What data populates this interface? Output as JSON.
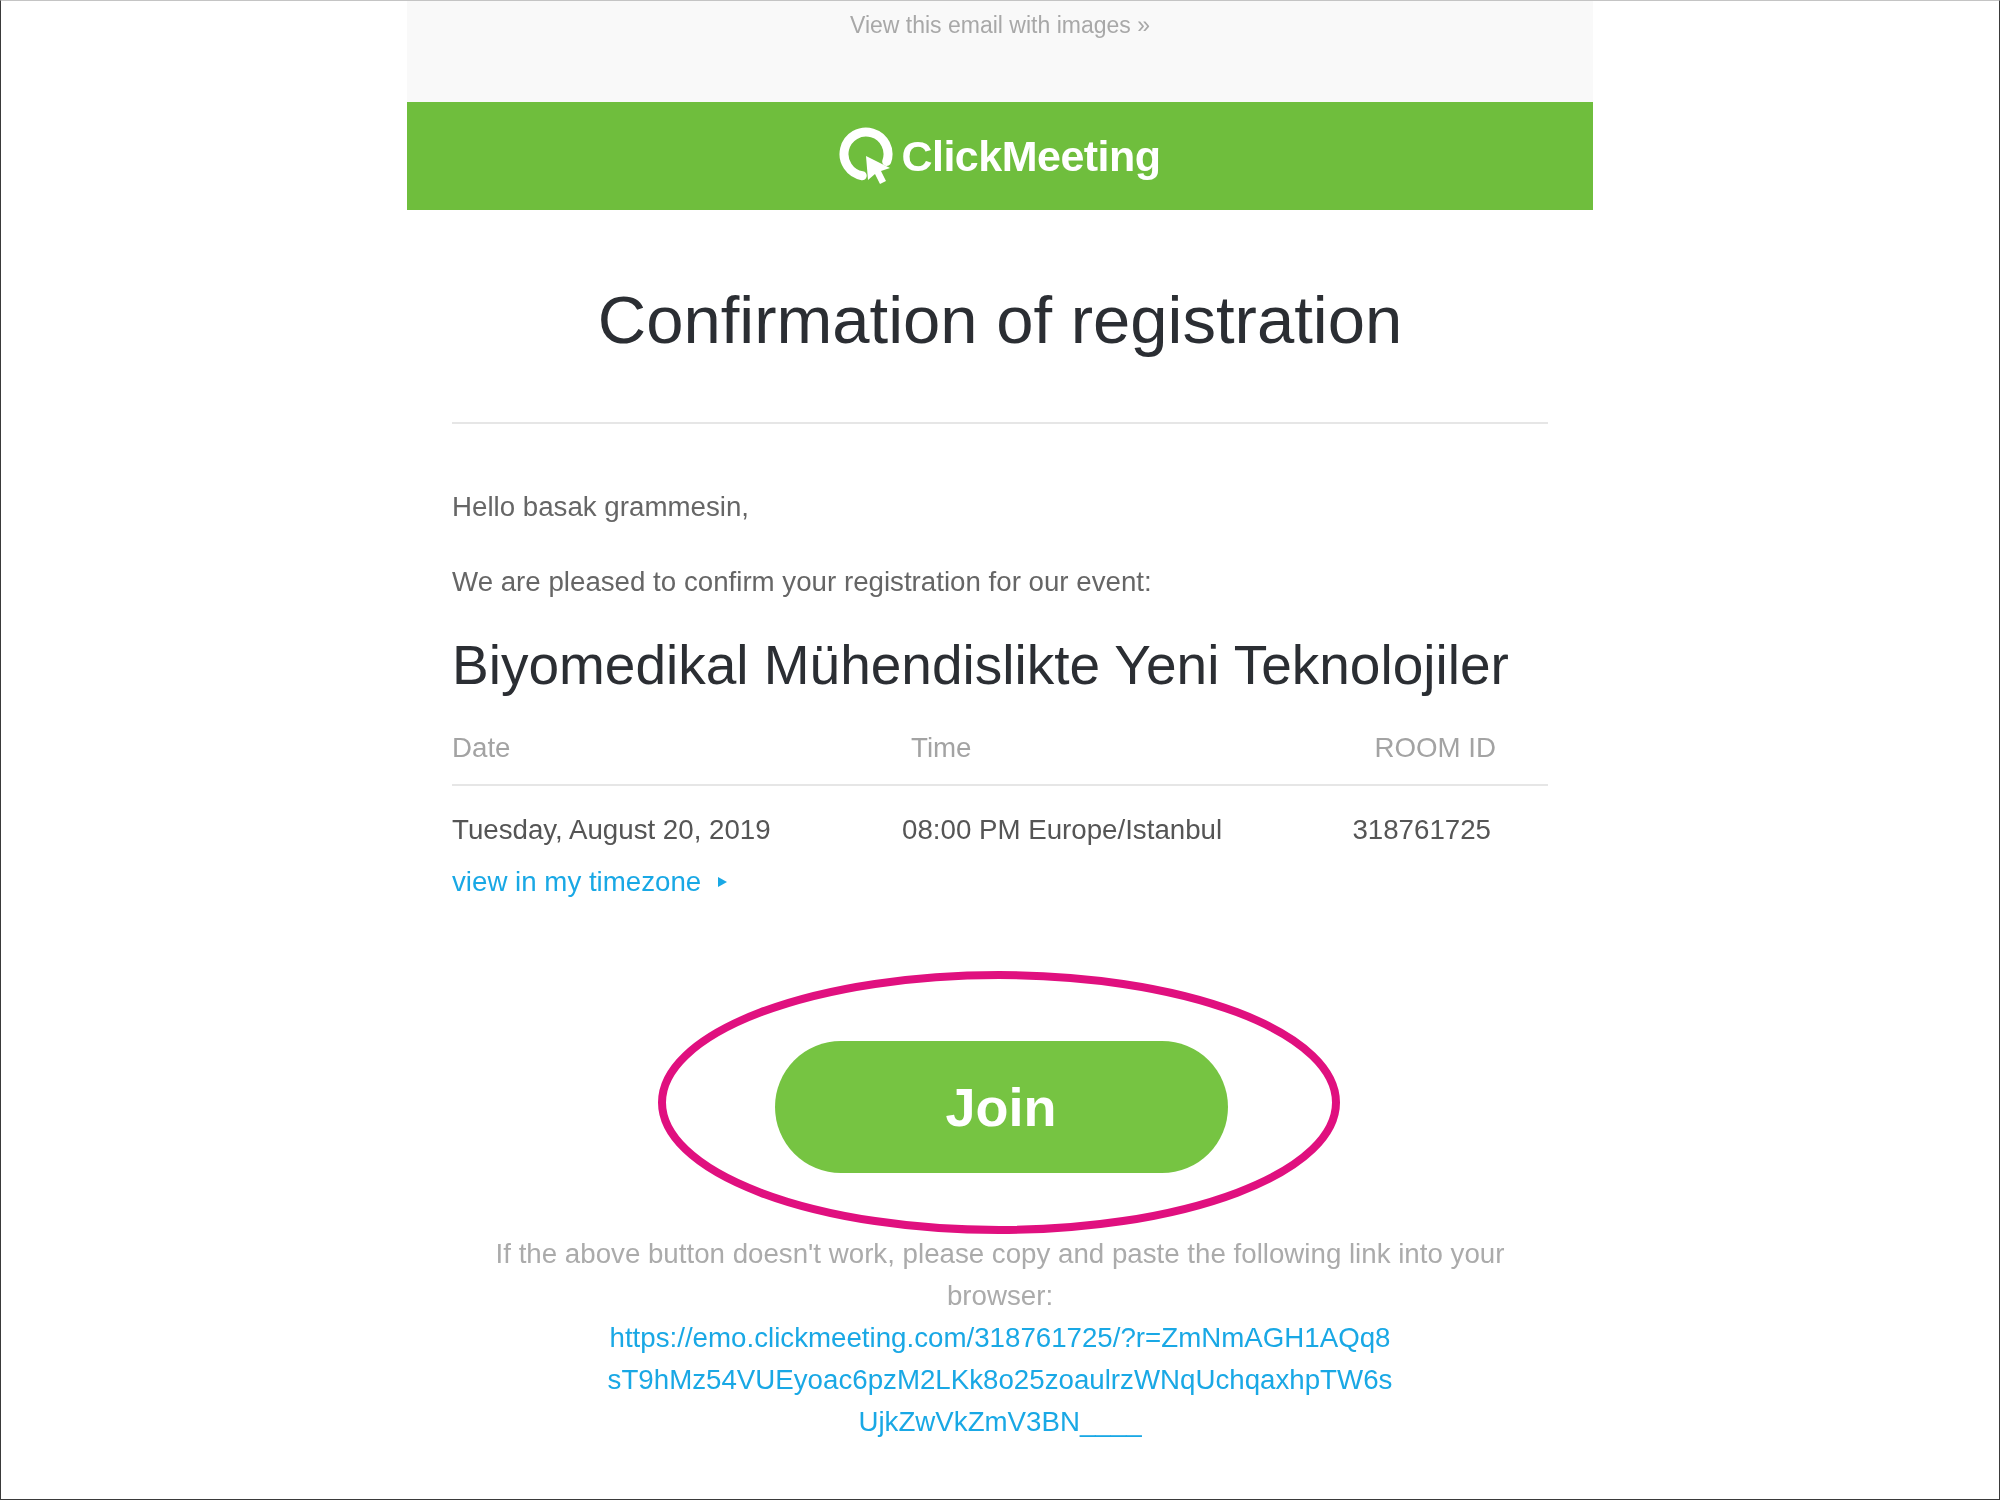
{
  "top_bar": {
    "link": "View this email with images »"
  },
  "header": {
    "logo_text": "ClickMeeting"
  },
  "title": "Confirmation of registration",
  "greeting": "Hello basak grammesin,",
  "intro": "We are pleased to confirm your registration for our event:",
  "event_title": "Biyomedikal Mühendislikte Yeni Teknolojiler",
  "details_table": {
    "columns": [
      "Date",
      "Time",
      "ROOM ID"
    ],
    "rows": [
      [
        "Tuesday, August 20, 2019",
        "08:00 PM Europe/Istanbul",
        "318761725"
      ]
    ]
  },
  "timezone_link": "view in my timezone",
  "join_button": {
    "label": "Join",
    "highlighted": true
  },
  "fallback": {
    "text": "If the above button doesn't work, please copy and paste the following link into your browser:",
    "link": "https://emo.clickmeeting.com/318761725/?r=ZmNmAGH1AQq8sT9hMz54VUEyoac6pzM2LKk8o25zoaulrzWNqUchqaxhpTW6sUjkZwVkZmV3BN____"
  }
}
